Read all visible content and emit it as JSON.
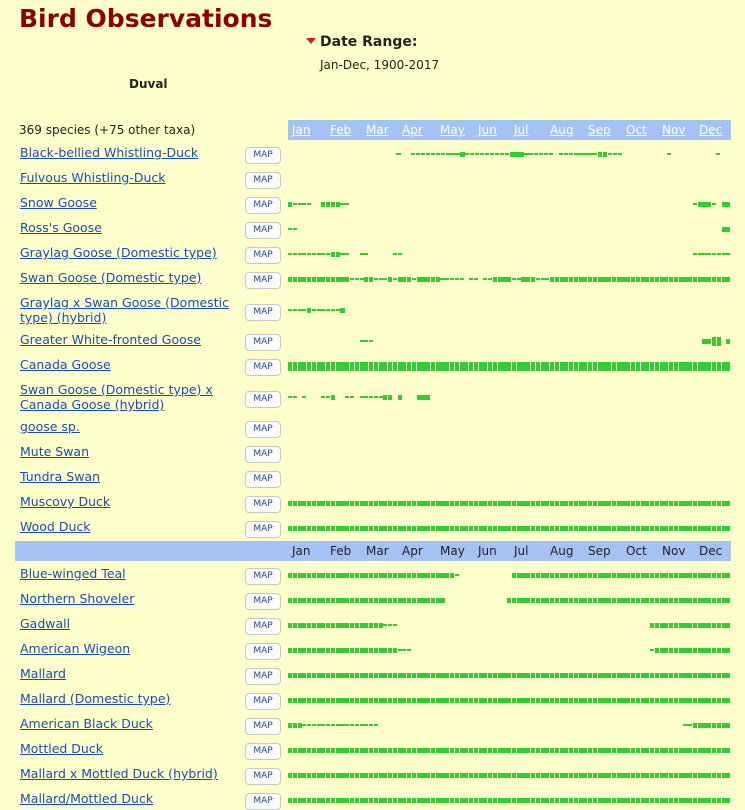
{
  "title": "Bird Observations",
  "date_range": {
    "label": "Date Range:",
    "value": "Jan-Dec, 1900-2017"
  },
  "region": "Duval",
  "species_count": "369 species (+75 other taxa)",
  "map_label": "MAP",
  "colors": {
    "title": "#8b0000",
    "bar": "#33cc33",
    "header": "#a4c2f4",
    "link": "#1a4db0",
    "background": "#ffffcc"
  },
  "months": [
    "Jan",
    "Feb",
    "Mar",
    "Apr",
    "May",
    "Jun",
    "Jul",
    "Aug",
    "Sep",
    "Oct",
    "Nov",
    "Dec"
  ],
  "species": [
    {
      "name": "Black-bellied Whistling-Duck",
      "bars": "000000000000000000000010011111111112111111111222111111011111111221110000000001000000000100"
    },
    {
      "name": "Fulvous Whistling-Duck",
      "bars": "000000000000000000000000000000000000000000000000000000000000000000000000000000000000000000"
    },
    {
      "name": "Snow Goose",
      "bars": "211110022221100000000000000000000000000000000000000000000000000000000000000000000000012221022"
    },
    {
      "name": "Ross's Goose",
      "bars": "110000000000000000000000000000000000000000000000000000000000000000000000000000000000000000022"
    },
    {
      "name": "Graylag Goose (Domestic type)",
      "bars": "111111111221100110000011000000000000000000000000000000000000000000000000000000000000011111111"
    },
    {
      "name": "Swan Goose (Domestic type)",
      "bars": "222222222222211122111212221222221111101101122221122211122222222222222222222222222222222222222"
    },
    {
      "name": "Graylag x Swan Goose (Domestic type) (hybrid)",
      "bars": "111121111112000000000000000000000000000000000000000000000000000000000000000000000000000000000"
    },
    {
      "name": "Greater White-fronted Goose",
      "bars": "000000000000000111000000000000000000000000000000000000000000000000000000000000000000000223302"
    },
    {
      "name": "Canada Goose",
      "bars": "333333333333333333333333333333333333333333333333333333333333333333333333333333333333333333333"
    },
    {
      "name": "Swan Goose (Domestic type) x Canada Goose (hybrid)",
      "bars": "110100011200110111112202000222000000000000000000000000000000000000000000000000000000000000000"
    },
    {
      "name": "goose sp.",
      "bars": "000000000000000000000000000000000000000000000000000000000000000000000000000000000000000000000"
    },
    {
      "name": "Mute Swan",
      "bars": "000000000000000000000000000000000000000000000000000000000000000000000000000000000000000000000"
    },
    {
      "name": "Tundra Swan",
      "bars": "000000000000000000000000000000000000000000000000000000000000000000000000000000000000000000000"
    },
    {
      "name": "Muscovy Duck",
      "bars": "222222222222222222222222222222222222222222222222222222222222222222222222222222222222222222222"
    },
    {
      "name": "Wood Duck",
      "bars": "222222222222222222222222222222222222222222222222222222222222222222222222222222222222222222222"
    },
    {
      "name": "Blue-winged Teal",
      "bars": "222222222222222222222222222222222221000000000002222222222222222222222222222222222222222222222"
    },
    {
      "name": "Northern Shoveler",
      "bars": "222222222222222222222222222222222000000000000022222222222222222222222222222222222222222222222"
    },
    {
      "name": "Gadwall",
      "bars": "222222222222222222221110000000000000000000000000000000000000000000000000000022222222222222222"
    },
    {
      "name": "American Wigeon",
      "bars": "222222222222222222222221110000000000000000000000000000000000000000000000000012222222222222222"
    },
    {
      "name": "Mallard",
      "bars": "222222222222222222222222222222222222222222222222222222222222222222222222222222222222222222222"
    },
    {
      "name": "Mallard (Domestic type)",
      "bars": "222222222222222222222222222222222222222222222222222222222222222222222222222222222222222222222"
    },
    {
      "name": "American Black Duck",
      "bars": "222111111111111111100000000000000000000000000000000000000000000000000000000000000001122222222"
    },
    {
      "name": "Mottled Duck",
      "bars": "222222222222222222222222222222222222222222222222222222222222222222222222222222222222222222222"
    },
    {
      "name": "Mallard x Mottled Duck (hybrid)",
      "bars": "222222222222222222222222222222222222222222222222222222222222222222222222222222222222222222222"
    },
    {
      "name": "Mallard/Mottled Duck",
      "bars": "222222222222222222222222222222222222222222222222222222222222222222222222222222222222222222222"
    }
  ]
}
